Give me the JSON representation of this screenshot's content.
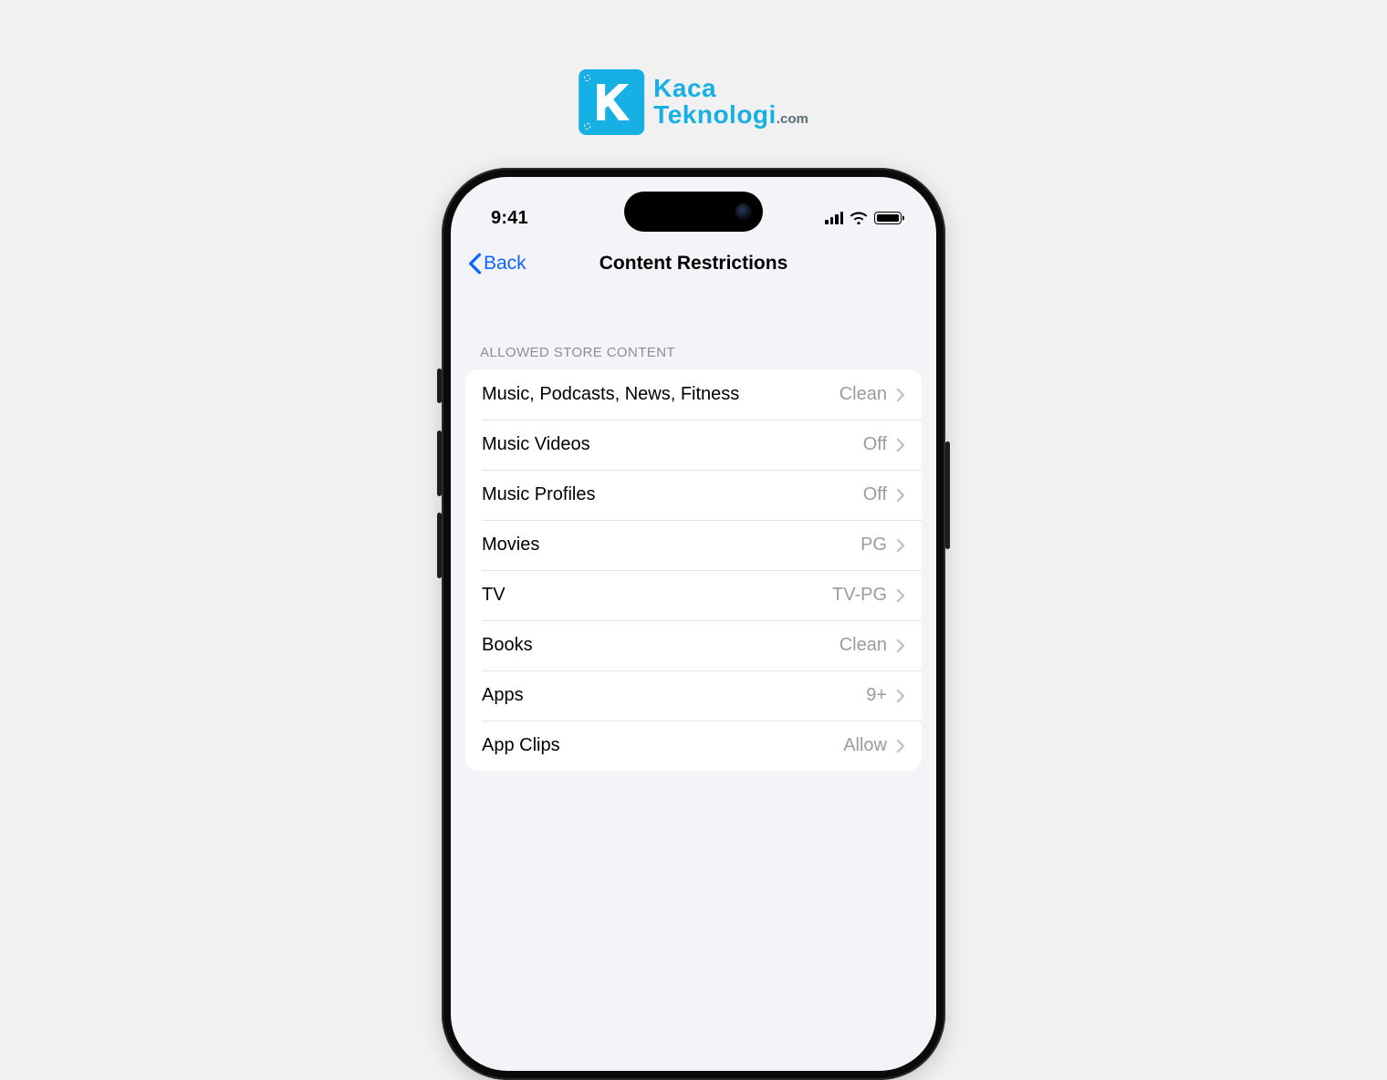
{
  "brand": {
    "line1": "Kaca",
    "line2": "Teknologi",
    "suffix": ".com"
  },
  "statusbar": {
    "time": "9:41"
  },
  "nav": {
    "back_label": "Back",
    "title": "Content Restrictions"
  },
  "section": {
    "header": "ALLOWED STORE CONTENT"
  },
  "rows": [
    {
      "label": "Music, Podcasts, News, Fitness",
      "value": "Clean"
    },
    {
      "label": "Music Videos",
      "value": "Off"
    },
    {
      "label": "Music Profiles",
      "value": "Off"
    },
    {
      "label": "Movies",
      "value": "PG"
    },
    {
      "label": "TV",
      "value": "TV-PG"
    },
    {
      "label": "Books",
      "value": "Clean"
    },
    {
      "label": "Apps",
      "value": "9+"
    },
    {
      "label": "App Clips",
      "value": "Allow"
    }
  ]
}
